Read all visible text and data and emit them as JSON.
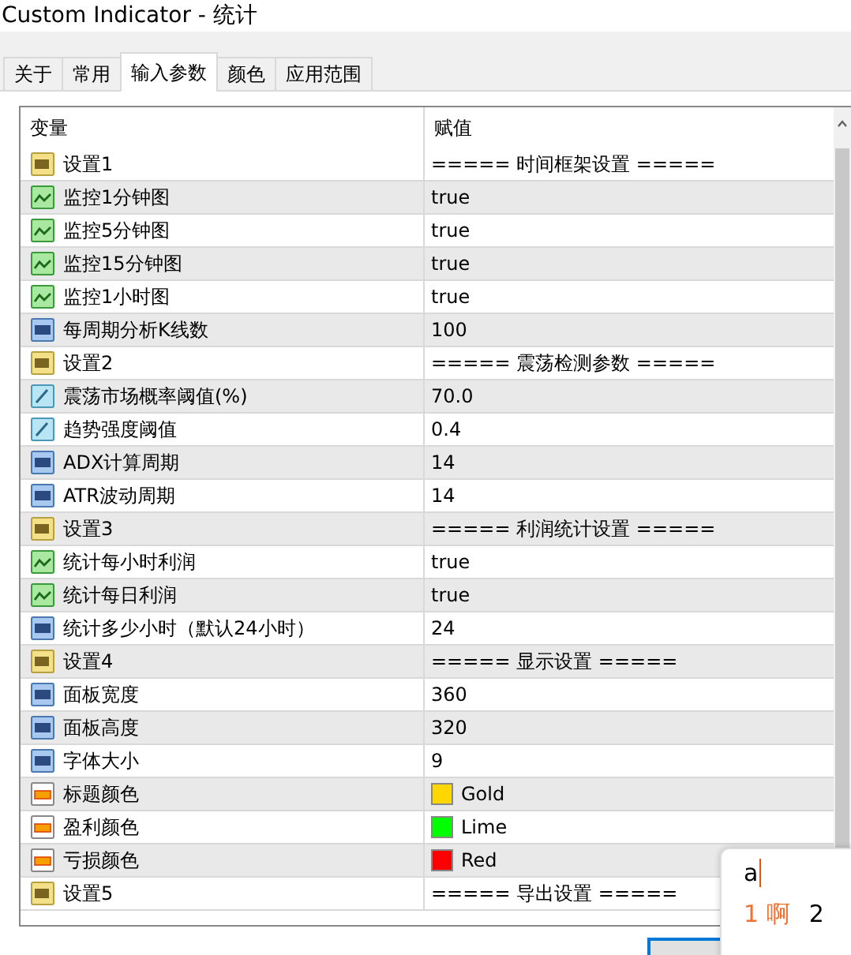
{
  "window": {
    "title": "Custom Indicator - 统计"
  },
  "tabs": [
    {
      "label": "关于",
      "selected": false
    },
    {
      "label": "常用",
      "selected": false
    },
    {
      "label": "输入参数",
      "selected": true
    },
    {
      "label": "颜色",
      "selected": false
    },
    {
      "label": "应用范围",
      "selected": false
    }
  ],
  "table": {
    "columns": [
      "变量",
      "赋值"
    ],
    "rows": [
      {
        "kind": "string",
        "name": "设置1",
        "value": "===== 时间框架设置 ====="
      },
      {
        "kind": "bool",
        "name": "监控1分钟图",
        "value": "true"
      },
      {
        "kind": "bool",
        "name": "监控5分钟图",
        "value": "true"
      },
      {
        "kind": "bool",
        "name": "监控15分钟图",
        "value": "true"
      },
      {
        "kind": "bool",
        "name": "监控1小时图",
        "value": "true"
      },
      {
        "kind": "int",
        "name": "每周期分析K线数",
        "value": "100"
      },
      {
        "kind": "string",
        "name": "设置2",
        "value": "===== 震荡检测参数 ====="
      },
      {
        "kind": "double",
        "name": "震荡市场概率阈值(%)",
        "value": "70.0"
      },
      {
        "kind": "double",
        "name": "趋势强度阈值",
        "value": "0.4"
      },
      {
        "kind": "int",
        "name": "ADX计算周期",
        "value": "14"
      },
      {
        "kind": "int",
        "name": "ATR波动周期",
        "value": "14"
      },
      {
        "kind": "string",
        "name": "设置3",
        "value": "===== 利润统计设置 ====="
      },
      {
        "kind": "bool",
        "name": "统计每小时利润",
        "value": "true"
      },
      {
        "kind": "bool",
        "name": "统计每日利润",
        "value": "true"
      },
      {
        "kind": "int",
        "name": "统计多少小时（默认24小时）",
        "value": "24"
      },
      {
        "kind": "string",
        "name": "设置4",
        "value": "===== 显示设置 ====="
      },
      {
        "kind": "int",
        "name": "面板宽度",
        "value": "360"
      },
      {
        "kind": "int",
        "name": "面板高度",
        "value": "320"
      },
      {
        "kind": "int",
        "name": "字体大小",
        "value": "9"
      },
      {
        "kind": "color",
        "name": "标题颜色",
        "value": "Gold",
        "color": "#ffd700"
      },
      {
        "kind": "color",
        "name": "盈利颜色",
        "value": "Lime",
        "color": "#00ff00"
      },
      {
        "kind": "color",
        "name": "亏损颜色",
        "value": "Red",
        "color": "#ff0000"
      },
      {
        "kind": "string",
        "name": "设置5",
        "value": "===== 导出设置 ====="
      }
    ]
  },
  "ime": {
    "input": "a",
    "candidates": [
      {
        "label": "1 啊",
        "selected": true
      },
      {
        "label": "2",
        "selected": false
      }
    ]
  }
}
